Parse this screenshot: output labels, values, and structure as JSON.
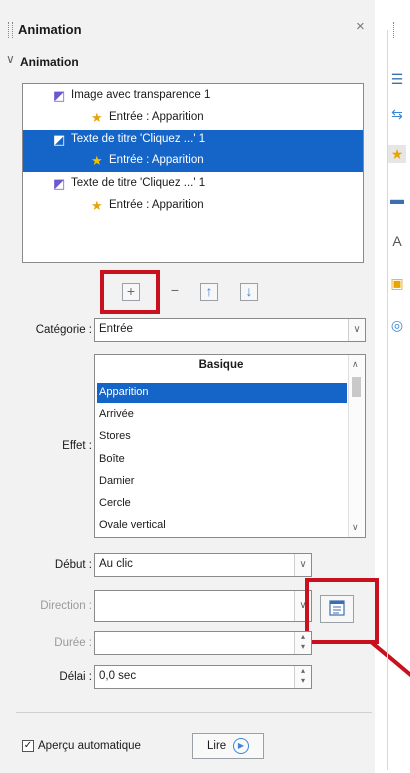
{
  "panel": {
    "title": "Animation",
    "close_glyph": "×",
    "section_title": "Animation"
  },
  "animation_list": [
    {
      "icon": "object-icon",
      "text": "Image avec transparence 1",
      "indent": 1,
      "selected": false
    },
    {
      "icon": "star-icon",
      "text": "Entrée : Apparition",
      "indent": 2,
      "selected": false
    },
    {
      "icon": "object-icon",
      "text": "Texte de titre 'Cliquez ...' 1",
      "indent": 1,
      "selected": true
    },
    {
      "icon": "star-icon",
      "text": "Entrée : Apparition",
      "indent": 2,
      "selected": true
    },
    {
      "icon": "object-icon",
      "text": "Texte de titre 'Cliquez ...' 1",
      "indent": 1,
      "selected": false
    },
    {
      "icon": "star-icon",
      "text": "Entrée : Apparition",
      "indent": 2,
      "selected": false
    }
  ],
  "toolbar": {
    "add_glyph": "+",
    "remove_glyph": "−",
    "up_glyph": "↑",
    "down_glyph": "↓"
  },
  "category": {
    "label": "Catégorie :",
    "value": "Entrée"
  },
  "effect": {
    "label": "Effet :",
    "group_header": "Basique",
    "items": [
      "Apparition",
      "Arrivée",
      "Stores",
      "Boîte",
      "Damier",
      "Cercle",
      "Ovale vertical"
    ],
    "selected_index": 0
  },
  "start": {
    "label": "Début :",
    "value": "Au clic"
  },
  "direction": {
    "label": "Direction :",
    "value": ""
  },
  "duration": {
    "label": "Durée :",
    "value": ""
  },
  "delay": {
    "label": "Délai :",
    "value": "0,0 sec"
  },
  "autopreview": {
    "label": "Aperçu automatique",
    "checked": true
  },
  "play_button": {
    "label": "Lire"
  },
  "colors": {
    "selection": "#1565c8",
    "highlight": "#c8101e",
    "panel_bg": "#f2f2f2"
  },
  "sidebar_icons": [
    "properties-icon",
    "slide-transition-icon",
    "animation-icon",
    "master-slides-icon",
    "styles-icon",
    "gallery-icon",
    "navigator-icon"
  ]
}
